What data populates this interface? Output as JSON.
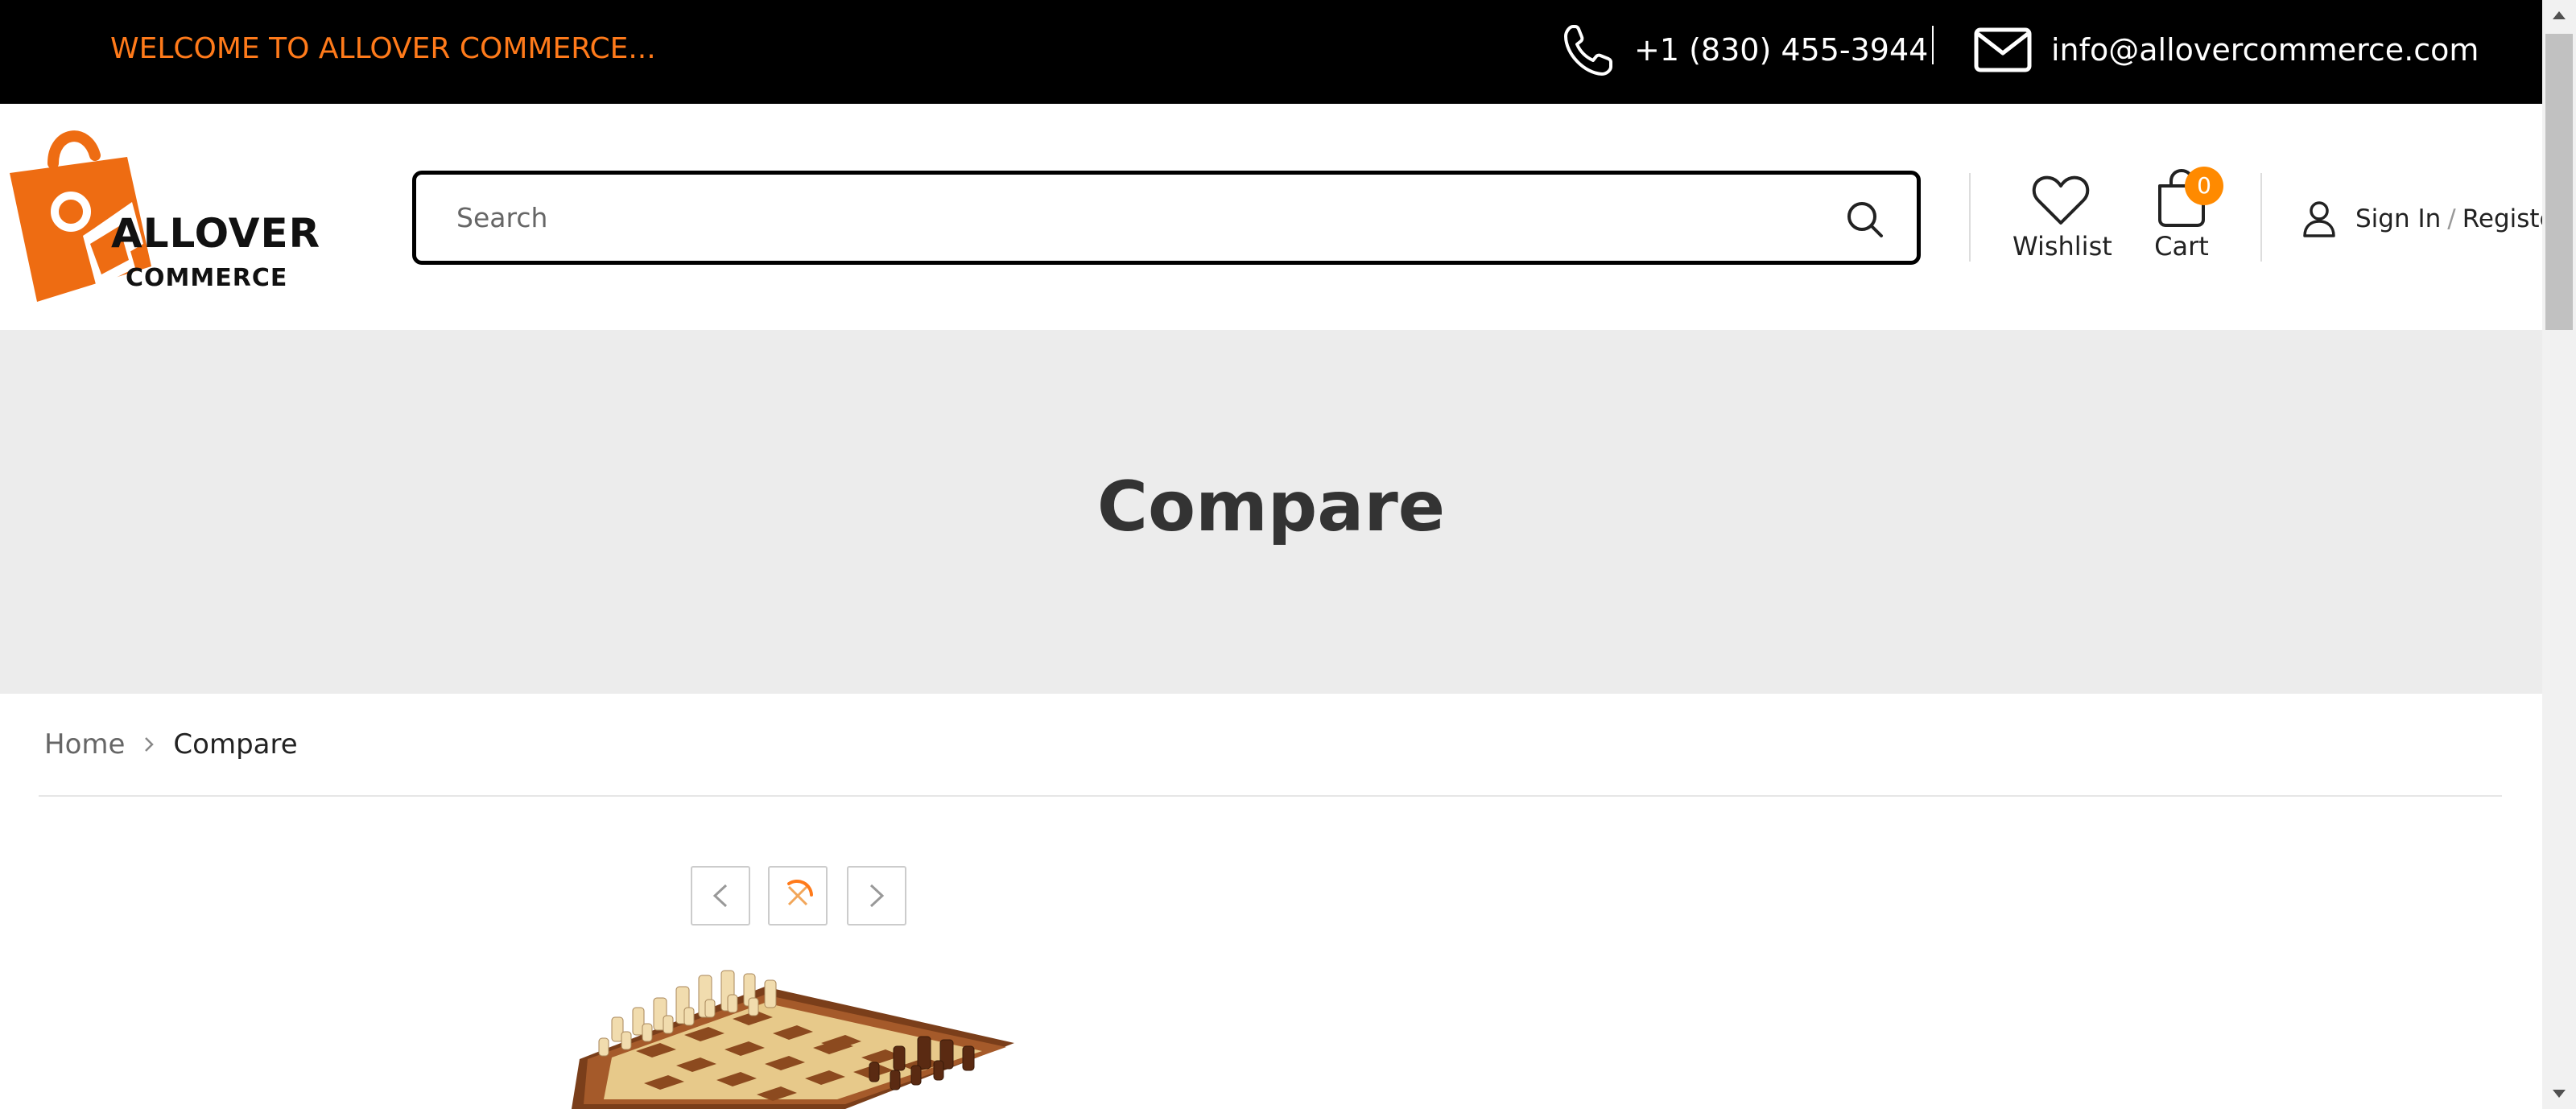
{
  "topbar": {
    "welcome": "WELCOME TO ALLOVER COMMERCE...",
    "phone": "+1 (830) 455-3944",
    "email": "info@allovercommerce.com",
    "phone_icon": "phone-icon",
    "email_icon": "mail-icon"
  },
  "header": {
    "logo_title": "ALLOVER",
    "logo_subtitle": "COMMERCE",
    "search": {
      "placeholder": "Search",
      "value": ""
    },
    "wishlist_label": "Wishlist",
    "cart_label": "Cart",
    "cart_count": "0",
    "signin_label": "Sign In",
    "separator": "/",
    "register_label": "Register"
  },
  "banner": {
    "title": "Compare"
  },
  "breadcrumb": {
    "home": "Home",
    "current": "Compare"
  },
  "colors": {
    "accent": "#ff7a1a",
    "badge": "#ff8a00",
    "topbar_bg": "#000000",
    "banner_bg": "#ececec"
  }
}
